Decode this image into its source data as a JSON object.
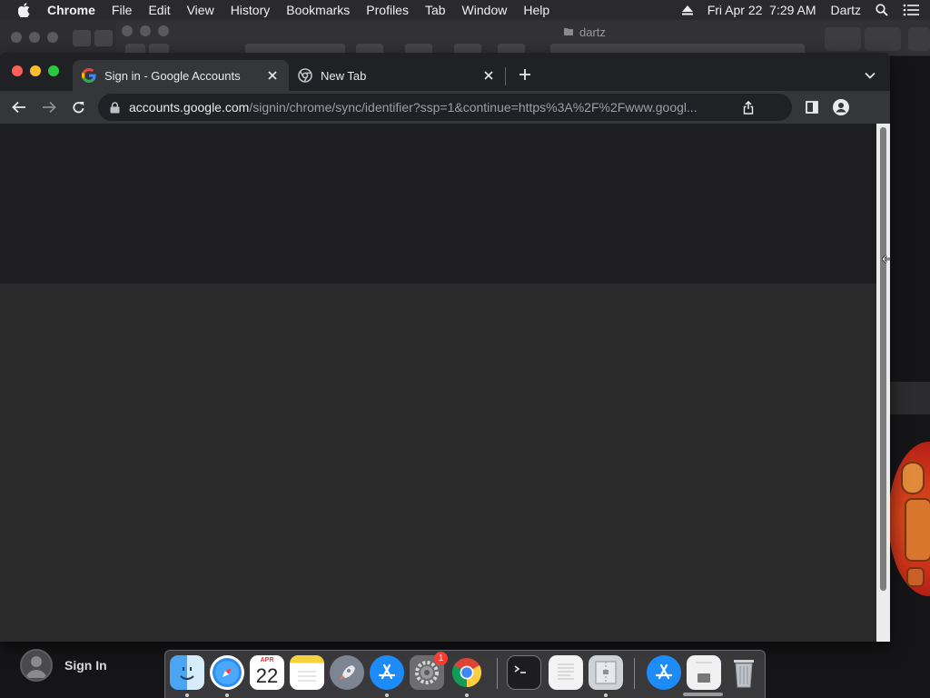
{
  "menubar": {
    "apple_icon": "apple-icon",
    "app_name": "Chrome",
    "items": [
      "File",
      "Edit",
      "View",
      "History",
      "Bookmarks",
      "Profiles",
      "Tab",
      "Window",
      "Help"
    ],
    "datetime": "Fri Apr 22  7:29 AM",
    "user": "Dartz",
    "status_icons": [
      "eject-icon",
      "spotlight-search-icon",
      "control-center-icon"
    ]
  },
  "background_window": {
    "title": "dartz"
  },
  "chrome": {
    "tabs": [
      {
        "title": "Sign in - Google Accounts",
        "favicon": "google-g-icon",
        "active": true
      },
      {
        "title": "New Tab",
        "favicon": "chrome-icon",
        "active": false
      }
    ],
    "omnibox": {
      "host": "accounts.google.com",
      "path": "/signin/chrome/sync/identifier?ssp=1&continue=https%3A%2F%2Fwww.googl..."
    }
  },
  "sign_in": {
    "label": "Sign In"
  },
  "dock": {
    "calendar_month": "APR",
    "calendar_day": "22",
    "system_prefs_badge": "1",
    "apps": [
      "Finder",
      "Safari",
      "Calendar",
      "Notes",
      "Launchpad",
      "App Store",
      "System Preferences",
      "Google Chrome",
      "Terminal",
      "TextEdit",
      "Archive Utility",
      "Downloads",
      "Documents",
      "Trash"
    ]
  },
  "colors": {
    "menubar_bg": "#2a2a2c",
    "tabstrip_bg": "#202124",
    "active_tab_bg": "#35363a",
    "content_top": "#1e1e20",
    "content_bottom": "#2a2a2b"
  }
}
